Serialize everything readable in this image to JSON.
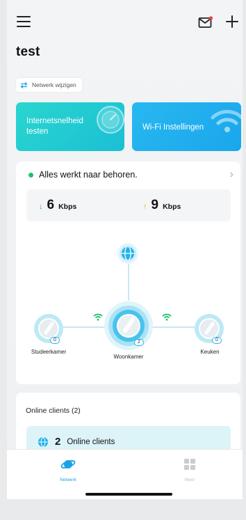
{
  "header": {
    "title": "test",
    "network_change_label": "Netwerk wijzigen"
  },
  "tiles": {
    "speed_test_label": "Internetsnelheid testen",
    "wifi_settings_label": "Wi-Fi Instellingen"
  },
  "status": {
    "text": "Alles werkt naar behoren.",
    "color": "#1ec36a"
  },
  "speed": {
    "download_value": "6",
    "download_unit": "Kbps",
    "upload_value": "9",
    "upload_unit": "Kbps"
  },
  "topology": {
    "nodes": [
      {
        "label": "Studeerkamer",
        "clients": "0"
      },
      {
        "label": "Woonkamer",
        "clients": "2"
      },
      {
        "label": "Keuken",
        "clients": "0"
      }
    ]
  },
  "clients": {
    "section_title": "Online clients (2)",
    "count": "2",
    "label": "Online clients"
  },
  "tabbar": {
    "tabs": [
      {
        "label": "Netwerk",
        "active": true,
        "color": "#1aa3e8"
      },
      {
        "label": "Meer",
        "active": false,
        "color": "#bfc3c8"
      }
    ]
  },
  "colors": {
    "accent": "#1aa6ec",
    "teal": "#29d6cf",
    "status_green": "#1ec36a"
  }
}
